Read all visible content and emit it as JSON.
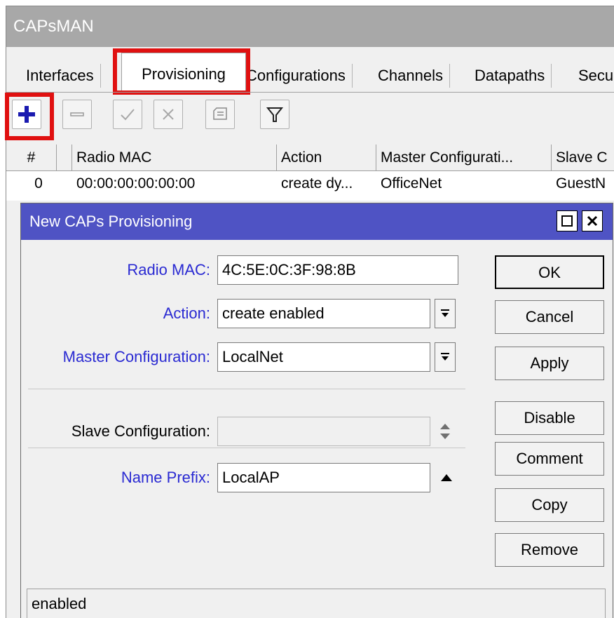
{
  "window": {
    "title": "CAPsMAN"
  },
  "tabs": [
    {
      "label": "Interfaces"
    },
    {
      "label": "Provisioning"
    },
    {
      "label": "Configurations"
    },
    {
      "label": "Channels"
    },
    {
      "label": "Datapaths"
    },
    {
      "label": "Secu"
    }
  ],
  "toolbar": {
    "add": "plus-icon",
    "remove": "minus-icon",
    "enable": "check-icon",
    "disable": "cross-icon",
    "comment": "note-icon",
    "filter": "filter-icon"
  },
  "table": {
    "columns": [
      "#",
      "Radio MAC",
      "Action",
      "Master Configurati...",
      "Slave C"
    ],
    "rows": [
      [
        "0",
        "00:00:00:00:00:00",
        "create dy...",
        "OfficeNet",
        "GuestN"
      ]
    ]
  },
  "dialog": {
    "title": "New CAPs Provisioning",
    "fields": {
      "radio_mac": {
        "label": "Radio MAC:",
        "value": "4C:5E:0C:3F:98:8B"
      },
      "action": {
        "label": "Action:",
        "value": "create enabled"
      },
      "master_configuration": {
        "label": "Master Configuration:",
        "value": "LocalNet"
      },
      "slave_configuration": {
        "label": "Slave Configuration:",
        "value": ""
      },
      "name_prefix": {
        "label": "Name Prefix:",
        "value": "LocalAP"
      }
    },
    "buttons": {
      "ok": "OK",
      "cancel": "Cancel",
      "apply": "Apply",
      "disable": "Disable",
      "comment": "Comment",
      "copy": "Copy",
      "remove": "Remove"
    },
    "status": "enabled"
  },
  "colors": {
    "dialog_title_bg": "#4f53c4",
    "required_label": "#2a2ad2",
    "highlight": "#e01010",
    "add_icon": "#1a1ab0"
  }
}
